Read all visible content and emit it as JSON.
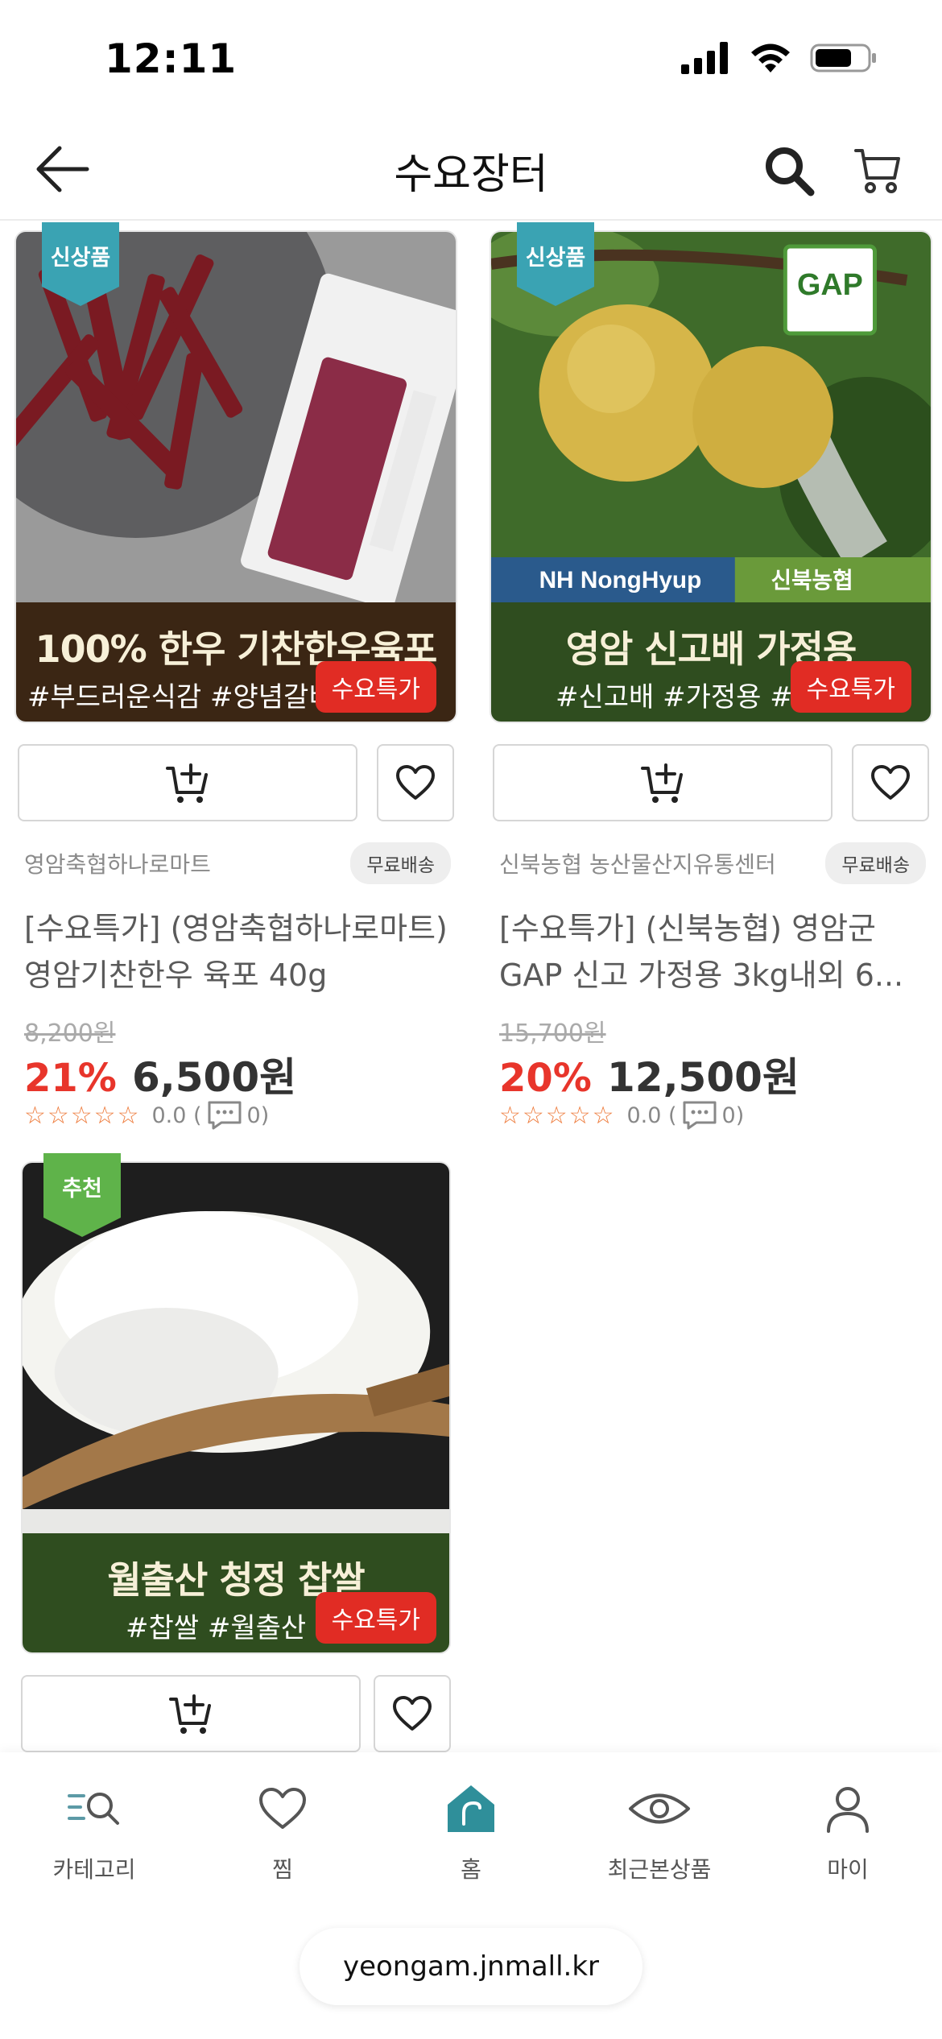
{
  "status_bar": {
    "time": "12:11"
  },
  "header": {
    "title": "수요장터"
  },
  "products": [
    {
      "badge": "신상품",
      "banner_title": "100% 한우 기찬한우육포",
      "banner_tags": "#부드러운식감 #양념갈비맛 #",
      "sale_chip": "수요특가",
      "seller": "영암축협하나로마트",
      "shipping": "무료배송",
      "name": "[수요특가] (영암축협하나로마트) 영암기찬한우 육포 40g",
      "original_price": "8,200원",
      "discount": "21%",
      "price": "6,500원",
      "rating": "0.0 (",
      "reviews": "0)"
    },
    {
      "badge": "신상품",
      "banner_title": "영암 신고배 가정용",
      "banner_tags": "#신고배 #가정용 #GA",
      "sale_chip": "수요특가",
      "seller": "신북농협 농산물산지유통센터",
      "shipping": "무료배송",
      "name": "[수요특가] (신북농협) 영암군 GAP 신고 가정용 3kg내외 6...",
      "original_price": "15,700원",
      "discount": "20%",
      "price": "12,500원",
      "rating": "0.0 (",
      "reviews": "0)",
      "photo_labels": {
        "gap": "GAP",
        "nh": "NH NongHyup",
        "coop": "신북농협"
      }
    },
    {
      "badge": "추천",
      "banner_title": "월출산 청정 찹쌀",
      "banner_tags": "#찹쌀 #월출산 #청",
      "sale_chip": "수요특가"
    }
  ],
  "bottom_nav": {
    "items": [
      {
        "label": "카테고리",
        "icon": "category-search-icon"
      },
      {
        "label": "찜",
        "icon": "heart-icon"
      },
      {
        "label": "홈",
        "icon": "home-icon"
      },
      {
        "label": "최근본상품",
        "icon": "eye-icon"
      },
      {
        "label": "마이",
        "icon": "person-icon"
      }
    ],
    "url": "yeongam.jnmall.kr"
  },
  "colors": {
    "sale_red": "#e12c24",
    "discount_red": "#e8352b",
    "badge_teal": "#3aa3b3",
    "badge_green": "#5fb34a",
    "home_teal": "#2f8f9a",
    "banner_green": "#2f4d1f",
    "banner_brown": "#3b2614"
  }
}
